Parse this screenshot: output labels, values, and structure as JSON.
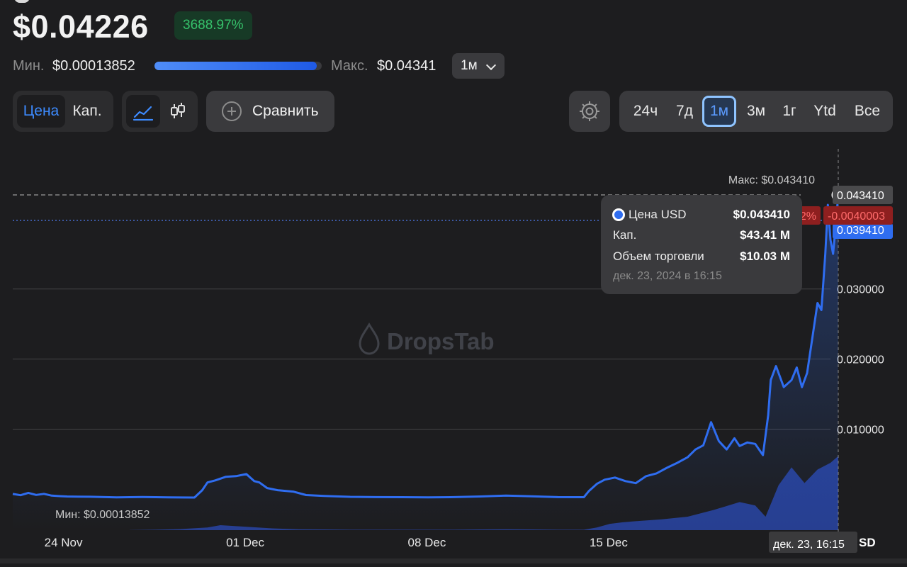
{
  "header": {
    "price": "$0.04226",
    "change_pct": "3688.97%",
    "min_label": "Мин.",
    "min_value": "$0.00013852",
    "max_label": "Макс.",
    "max_value": "$0.04341",
    "range_position": 0.97,
    "period_select": "1м"
  },
  "toolbar": {
    "mode_tabs": [
      {
        "label": "Цена",
        "active": true
      },
      {
        "label": "Кап.",
        "active": false
      }
    ],
    "chart_type_icons": [
      "line-chart-icon",
      "candlestick-icon"
    ],
    "compare_label": "Сравнить",
    "settings_icon": "gear-icon",
    "ranges": [
      {
        "label": "24ч",
        "active": false
      },
      {
        "label": "7д",
        "active": false
      },
      {
        "label": "1м",
        "active": true
      },
      {
        "label": "3м",
        "active": false
      },
      {
        "label": "1г",
        "active": false
      },
      {
        "label": "Ytd",
        "active": false
      },
      {
        "label": "Все",
        "active": false
      }
    ]
  },
  "tooltip": {
    "price_label": "Цена USD",
    "price_value": "$0.043410",
    "cap_label": "Кап.",
    "cap_value": "$43.41 M",
    "volume_label": "Объем торговли",
    "volume_value": "$10.03 M",
    "date": "дек. 23, 2024 в 16:15"
  },
  "chart_data": {
    "type": "line",
    "watermark": "DropsTab",
    "max_annotation": "Макс: $0.043410",
    "min_annotation": "Мин: $0.00013852",
    "crosshair_price": "0.043410",
    "crosshair_delta_pct": "-9.22%",
    "crosshair_delta": "-0.0040003",
    "current_price_tag": "0.039410",
    "crosshair_date": "дек. 23, 16:15",
    "axis_suffix": "SD",
    "y_ticks": [
      "0.010000",
      "0.020000",
      "0.030000"
    ],
    "y_tick_values": [
      0.01,
      0.02,
      0.03
    ],
    "x_ticks": [
      "24 Nov",
      "01 Dec",
      "08 Dec",
      "15 Dec"
    ],
    "x_tick_days": [
      0,
      7,
      14,
      21
    ],
    "ylim": [
      -0.0044,
      0.0515
    ],
    "xlim": [
      -1.0,
      30.5
    ],
    "colors": {
      "line": "#2f6df0",
      "volume": "#2b4bb8",
      "negative": "#d03a3a",
      "positive": "#36c26b"
    },
    "series": [
      {
        "x": [
          -1.0,
          -0.7,
          -0.4,
          -0.1,
          0.2,
          0.5,
          0.8,
          1.1,
          1.5,
          2,
          3,
          4,
          5,
          6,
          6.3,
          6.5,
          6.8,
          7.2,
          7.6,
          8.0,
          8.3,
          8.5,
          8.8,
          9.2,
          9.8,
          10.3,
          11,
          12,
          13,
          14,
          15,
          16,
          17,
          18,
          19,
          20,
          21,
          21.2,
          21.5,
          21.8,
          22.2,
          22.6,
          23.0,
          23.4,
          23.8,
          24.2,
          24.6,
          25.0,
          25.3,
          25.6,
          25.9,
          26.2,
          26.5,
          26.8,
          27.0,
          27.3,
          27.6,
          27.9,
          28.1,
          28.2,
          28.4,
          28.7,
          29.0,
          29.2,
          29.4,
          29.6,
          29.8,
          30.0,
          30.15,
          30.3,
          30.4,
          30.5,
          30.6,
          30.7,
          30.8
        ],
        "y": [
          0.00077,
          0.00058,
          0.00092,
          0.00062,
          0.00078,
          0.00052,
          0.00045,
          0.0004,
          0.00038,
          0.00036,
          0.00028,
          0.00032,
          0.00028,
          0.00025,
          0.0013,
          0.0024,
          0.0027,
          0.0032,
          0.0033,
          0.0036,
          0.0026,
          0.0024,
          0.0016,
          0.0013,
          0.0011,
          0.0006,
          0.00048,
          0.00035,
          0.00031,
          0.0003,
          0.00028,
          0.00031,
          0.0004,
          0.00052,
          0.00042,
          0.00031,
          0.0003,
          0.0012,
          0.0022,
          0.0028,
          0.0031,
          0.0026,
          0.0023,
          0.0033,
          0.0037,
          0.0045,
          0.0052,
          0.006,
          0.0071,
          0.0077,
          0.011,
          0.0083,
          0.0071,
          0.0087,
          0.0076,
          0.0081,
          0.0079,
          0.0063,
          0.012,
          0.017,
          0.019,
          0.016,
          0.017,
          0.0188,
          0.016,
          0.018,
          0.023,
          0.028,
          0.027,
          0.035,
          0.042,
          0.037,
          0.035,
          0.039,
          0.04341
        ]
      }
    ],
    "volume": {
      "x": [
        3.5,
        4.5,
        5.5,
        6.5,
        7.0,
        8.0,
        9.0,
        10,
        11,
        12,
        13,
        14,
        15,
        16,
        17,
        18,
        19,
        20,
        21,
        21.5,
        22,
        22.5,
        23,
        24,
        25,
        26,
        27,
        27.6,
        28.0,
        28.5,
        29,
        29.5,
        30,
        30.5,
        30.8
      ],
      "v": [
        0.05,
        0.2,
        0.5,
        1.2,
        2.2,
        1.5,
        0.8,
        0.4,
        0.3,
        0.2,
        0.2,
        0.2,
        0.2,
        0.2,
        0.3,
        0.4,
        0.3,
        0.2,
        0.2,
        1.2,
        2.8,
        3.5,
        4.0,
        4.8,
        6.0,
        9.0,
        12.5,
        11,
        6.0,
        20,
        28,
        21,
        27,
        30,
        33
      ]
    }
  }
}
